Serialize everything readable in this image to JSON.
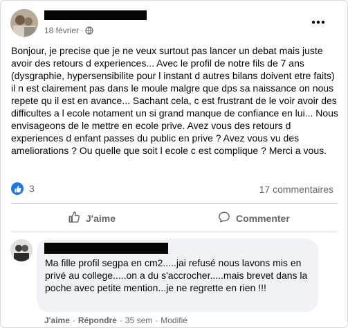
{
  "post": {
    "date": "18 février",
    "separator": "·",
    "body": "Bonjour, je precise que je ne veux surtout pas lancer un debat mais juste avoir des retours d experiences... Avec le profil de notre fils de 7 ans (dysgraphie, hypersensibilite pour l instant d autres bilans doivent etre faits) il n est clairement pas dans le moule malgre que dps sa naissance on nous repete qu il est en avance... Sachant cela, c est frustrant de le voir avoir des difficultes a l ecole notament un si grand manque de confiance en lui... Nous envisageons de le mettre en ecole prive. Avez vous des retours d experiences d enfant passes du public en prive ? Avez vous vu des ameliorations ? Ou quelle que soit l ecole c est complique ? Merci a vous.",
    "reaction_count": "3",
    "comments_count": "17 commentaires",
    "like_label": "J'aime",
    "comment_label": "Commenter"
  },
  "comment": {
    "text": "Ma fille profil segpa en cm2.....jai refusé nous lavons mis en privé au college.....on a du s'accrocher.....mais brevet dans la poche avec petite mention...je ne regrette en rien !!!",
    "like_label": "J'aime",
    "reply_label": "Répondre",
    "dot": "·",
    "age": "35 sem",
    "edited": "Modifié"
  },
  "colors": {
    "accent": "#1877f2",
    "secondary_text": "#65676b",
    "bubble": "#f0f2f5"
  },
  "icons": [
    "globe-icon",
    "more-options-icon",
    "like-reaction-icon",
    "thumbs-up-icon",
    "comment-icon"
  ]
}
